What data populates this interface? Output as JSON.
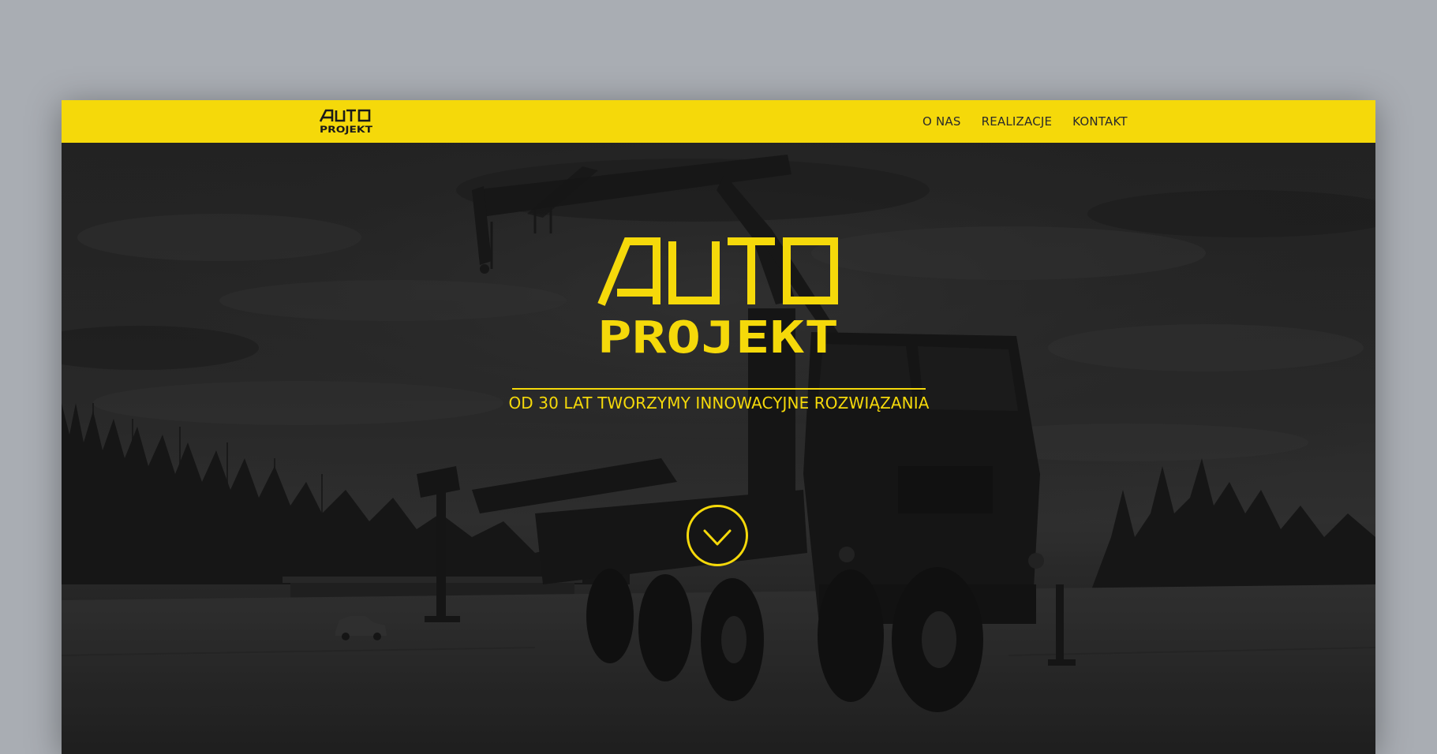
{
  "brand": {
    "logo_text_top": "AUTO",
    "logo_text_bottom": "PROJEKT",
    "logo_icon": "autoprojekt-logo"
  },
  "nav": {
    "items": [
      {
        "label": "O NAS"
      },
      {
        "label": "REALIZACJE"
      },
      {
        "label": "KONTAKT"
      }
    ]
  },
  "hero": {
    "logo_text_top": "AUTO",
    "logo_text_bottom": "PROJEKT",
    "tagline": "OD 30 LAT TWORZYMY INNOWACYJNE ROZWIĄZANIA",
    "scroll_icon": "chevron-down-circle-icon",
    "background_image": "crane-truck-photo"
  },
  "colors": {
    "accent": "#f5d90a",
    "nav_text": "#2a2a2a",
    "page_background": "#a9adb3",
    "hero_overlay": "#1b1b1b"
  }
}
